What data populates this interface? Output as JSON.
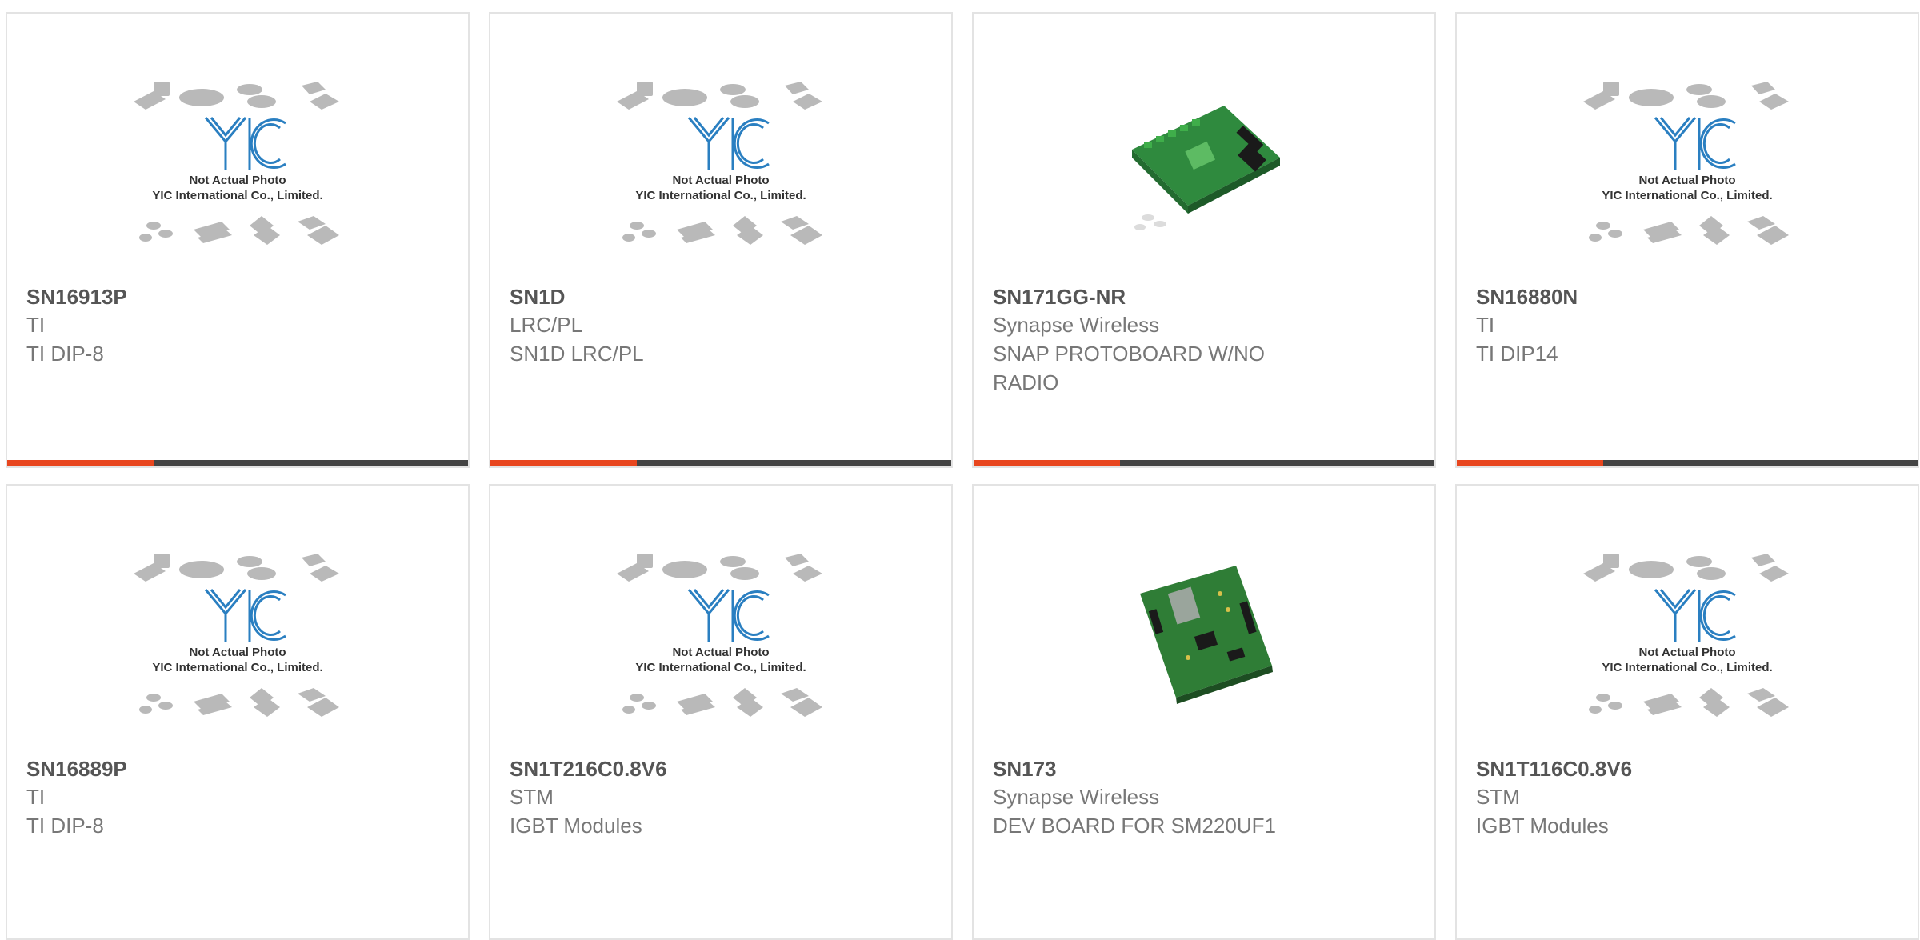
{
  "placeholder": {
    "caption_line1": "Not Actual Photo",
    "caption_line2": "YIC International Co., Limited.",
    "logo": "YIC"
  },
  "colors": {
    "accent": "#e8461e",
    "bar": "#444444",
    "logo": "#2a7fc1"
  },
  "products": [
    {
      "part": "SN16913P",
      "maker": "TI",
      "desc": "TI DIP-8",
      "image": "placeholder-yic"
    },
    {
      "part": "SN1D",
      "maker": "LRC/PL",
      "desc": "SN1D LRC/PL",
      "image": "placeholder-yic"
    },
    {
      "part": "SN171GG-NR",
      "maker": "Synapse Wireless",
      "desc": "SNAP PROTOBOARD W/NO RADIO",
      "image": "green-protoboard"
    },
    {
      "part": "SN16880N",
      "maker": "TI",
      "desc": "TI DIP14",
      "image": "placeholder-yic"
    },
    {
      "part": "SN16889P",
      "maker": "TI",
      "desc": "TI DIP-8",
      "image": "placeholder-yic"
    },
    {
      "part": "SN1T216C0.8V6",
      "maker": "STM",
      "desc": "IGBT Modules",
      "image": "placeholder-yic"
    },
    {
      "part": "SN173",
      "maker": "Synapse Wireless",
      "desc": "DEV BOARD FOR SM220UF1",
      "image": "green-devboard"
    },
    {
      "part": "SN1T116C0.8V6",
      "maker": "STM",
      "desc": "IGBT Modules",
      "image": "placeholder-yic"
    }
  ]
}
